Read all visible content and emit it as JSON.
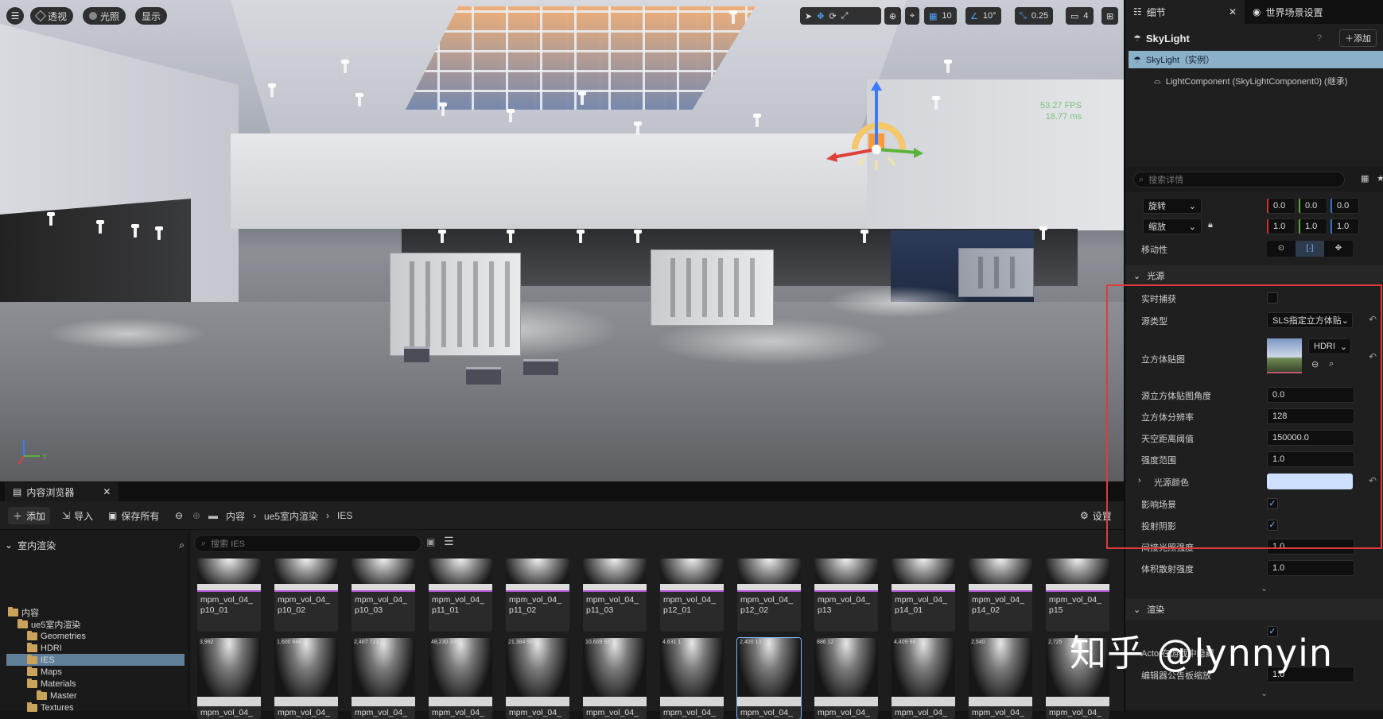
{
  "viewport": {
    "menu_icon": "hamburger-icon",
    "perspective_label": "透视",
    "lighting_label": "光照",
    "show_label": "显示",
    "grid_snap": "10",
    "angle_snap": "10°",
    "scale_snap": "0.25",
    "camera_speed": "4",
    "fps": "53.27 FPS",
    "frame_ms": "18.77 ms",
    "axis_y_label": "Y"
  },
  "content_browser": {
    "tab_label": "内容浏览器",
    "add_label": "添加",
    "import_label": "导入",
    "save_all_label": "保存所有",
    "breadcrumb": [
      "内容",
      "ue5室内渲染",
      "IES"
    ],
    "settings_label": "设置",
    "search_placeholder": "搜索 IES",
    "tree_header": "室内渲染",
    "tree": [
      {
        "label": "内容",
        "indent": 0
      },
      {
        "label": "ue5室内渲染",
        "indent": 1
      },
      {
        "label": "Geometries",
        "indent": 2
      },
      {
        "label": "HDRI",
        "indent": 2
      },
      {
        "label": "IES",
        "indent": 2,
        "selected": true
      },
      {
        "label": "Maps",
        "indent": 2
      },
      {
        "label": "Materials",
        "indent": 2
      },
      {
        "label": "Master",
        "indent": 3
      },
      {
        "label": "Textures",
        "indent": 2
      }
    ],
    "row1": [
      "mpm_vol_04_\np10_01",
      "mpm_vol_04_\np10_02",
      "mpm_vol_04_\np10_03",
      "mpm_vol_04_\np11_01",
      "mpm_vol_04_\np11_02",
      "mpm_vol_04_\np11_03",
      "mpm_vol_04_\np12_01",
      "mpm_vol_04_\np12_02",
      "mpm_vol_04_\np13",
      "mpm_vol_04_\np14_01",
      "mpm_vol_04_\np14_02",
      "mpm_vol_04_\np15"
    ],
    "row2_counts": [
      "3,992",
      "1,600 848",
      "2,487 721",
      "48,230 398",
      "21,384 959",
      "10,609 92",
      "4,631 1",
      "2,400 13",
      "886 12",
      "4,409 98",
      "2,540",
      "2,725"
    ],
    "row2_label": "mpm_vol_04_"
  },
  "details": {
    "tab_details": "细节",
    "tab_world": "世界场景设置",
    "actor_name": "SkyLight",
    "add_label": "添加",
    "instance_label": "SkyLight（实例）",
    "component_label": "LightComponent (SkyLightComponent0) (继承)",
    "search_placeholder": "搜索详情",
    "transform": {
      "rotation_label": "旋转",
      "rotation": [
        "0.0",
        "0.0",
        "0.0"
      ],
      "scale_label": "缩放",
      "scale": [
        "1.0",
        "1.0",
        "1.0"
      ],
      "mobility_label": "移动性"
    },
    "light_section": "光源",
    "props": {
      "realtime_capture": "实时捕获",
      "source_type": "源类型",
      "source_type_value": "SLS指定立方体贴",
      "cubemap": "立方体贴图",
      "cubemap_value": "HDRI",
      "cubemap_angle": "源立方体贴图角度",
      "cubemap_angle_value": "0.0",
      "cubemap_resolution": "立方体分辨率",
      "cubemap_resolution_value": "128",
      "sky_distance": "天空距离阈值",
      "sky_distance_value": "150000.0",
      "intensity_scale": "强度范围",
      "intensity_scale_value": "1.0",
      "light_color": "光源颜色",
      "affects_world": "影响场景",
      "cast_shadows": "投射阴影",
      "indirect_intensity": "间接光照强度",
      "indirect_intensity_value": "1.0",
      "volumetric_intensity": "体积散射强度",
      "volumetric_intensity_value": "1.0"
    },
    "render_section": "渲染",
    "render_props": {
      "actor_hidden": "Actor在游戏中隐藏",
      "billboard_scale": "编辑器公告板缩放",
      "billboard_scale_value": "1.0"
    }
  },
  "watermark": "知乎 @lynnyin",
  "colors": {
    "accent": "#7db7ff",
    "highlight_box": "#e23a3a",
    "light_color_swatch": "#cfe0ff"
  }
}
